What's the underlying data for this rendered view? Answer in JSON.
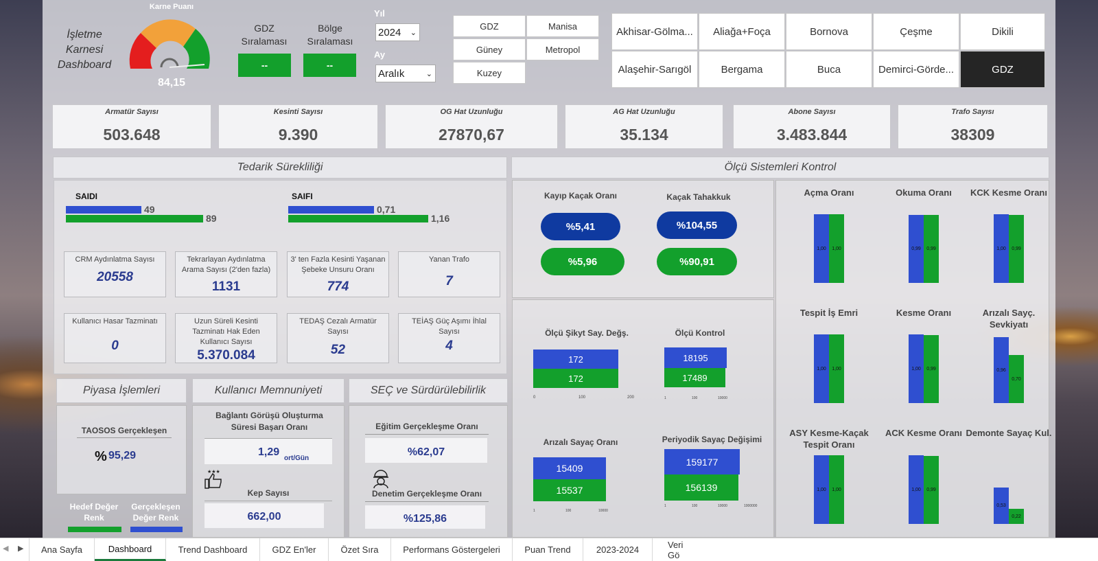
{
  "header": {
    "title_line1": "İşletme",
    "title_line2": "Karnesi",
    "title_line3": "Dashboard",
    "gauge_label": "Karne Puanı",
    "gauge_value": "84,15",
    "gdz_rank_label_1": "GDZ",
    "gdz_rank_label_2": "Sıralaması",
    "region_rank_label_1": "Bölge",
    "region_rank_label_2": "Sıralaması",
    "gdz_rank_value": "--",
    "region_rank_value": "--",
    "year_label": "Yıl",
    "year_value": "2024",
    "month_label": "Ay",
    "month_value": "Aralık"
  },
  "region_buttons": [
    "GDZ",
    "Manisa",
    "Güney",
    "Metropol",
    "Kuzey"
  ],
  "district_buttons": [
    "Akhisar-Gölma...",
    "Aliağa+Foça",
    "Bornova",
    "Çeşme",
    "Dikili",
    "Alaşehir-Sarıgöl",
    "Bergama",
    "Buca",
    "Demirci-Görde...",
    "GDZ"
  ],
  "kpis": [
    {
      "label": "Armatür  Sayısı",
      "value": "503.648"
    },
    {
      "label": "Kesinti Sayısı",
      "value": "9.390"
    },
    {
      "label": "OG Hat Uzunluğu",
      "value": "27870,67"
    },
    {
      "label": "AG Hat Uzunluğu",
      "value": "35.134"
    },
    {
      "label": "Abone Sayısı",
      "value": "3.483.844"
    },
    {
      "label": "Trafo Sayısı",
      "value": "38309"
    }
  ],
  "sections": {
    "supply": "Tedarik Sürekliliği",
    "measure": "Ölçü Sistemleri Kontrol",
    "market": "Piyasa İşlemleri",
    "satisfaction": "Kullanıcı Memnuniyeti",
    "sec": "SEÇ ve Sürdürülebilirlik"
  },
  "saidi": {
    "label": "SAIDI",
    "blue": "49",
    "green": "89",
    "blue_value": 49,
    "green_value": 89
  },
  "saifi": {
    "label": "SAIFI",
    "blue": "0,71",
    "green": "1,16",
    "blue_value": 0.71,
    "green_value": 1.16
  },
  "cards": [
    {
      "title": "CRM Aydınlatma Sayısı",
      "value": "20558"
    },
    {
      "title": "Tekrarlayan Aydınlatma Arama Sayısı (2'den fazla)",
      "value": "1131"
    },
    {
      "title": "3' ten Fazla Kesinti Yaşanan Şebeke Unsuru Oranı",
      "value": "774"
    },
    {
      "title": "Yanan Trafo",
      "value": "7"
    },
    {
      "title": "Kullanıcı Hasar Tazminatı",
      "value": "0"
    },
    {
      "title": "Uzun Süreli Kesinti Tazminatı Hak Eden Kullanıcı Sayısı",
      "value": "5.370.084"
    },
    {
      "title": "TEDAŞ Cezalı Armatür Sayısı",
      "value": "52"
    },
    {
      "title": "TEİAŞ Güç Aşımı İhlal Sayısı",
      "value": "4"
    }
  ],
  "market": {
    "title": "TAOSOS Gerçekleşen",
    "prefix": "%",
    "value": "95,29",
    "legend_target": "Hedef Değer Renk",
    "legend_actual": "Gerçekleşen Değer Renk"
  },
  "satisfaction": {
    "conn_title": "Bağlantı Görüşü Oluşturma Süresi Başarı Oranı",
    "conn_value": "1,29",
    "conn_unit": "ort/Gün",
    "kep_title": "Kep Sayısı",
    "kep_value": "662,00"
  },
  "sec": {
    "edu_title": "Eğitim Gerçekleşme Oranı",
    "edu_value": "%62,07",
    "audit_title": "Denetim Gerçekleşme Oranı",
    "audit_value": "%125,86"
  },
  "loss": {
    "title1": "Kayıp Kaçak Oranı",
    "title2": "Kaçak Tahakkuk",
    "blue1": "%5,41",
    "green1": "%5,96",
    "blue2": "%104,55",
    "green2": "%90,91"
  },
  "meter": {
    "complaint_title": "Ölçü Şikyt Say. Değş.",
    "complaint_blue": "172",
    "complaint_green": "172",
    "complaint_ticks": [
      "0",
      "100",
      "200"
    ],
    "control_title": "Ölçü Kontrol",
    "control_blue": "18195",
    "control_green": "17489",
    "control_ticks": [
      "1",
      "100",
      "10000"
    ],
    "faulty_title": "Arızalı Sayaç Oranı",
    "faulty_blue": "15409",
    "faulty_green": "15537",
    "faulty_ticks": [
      "1",
      "100",
      "10000"
    ],
    "periodic_title": "Periyodik Sayaç Değişimi",
    "periodic_blue": "159177",
    "periodic_green": "156139",
    "periodic_ticks": [
      "1",
      "100",
      "10000",
      "1000000"
    ]
  },
  "ratios": [
    {
      "title": "Açma Oranı",
      "blue": "1,00",
      "green": "1,00",
      "bv": 1.0,
      "gv": 1.0
    },
    {
      "title": "Okuma Oranı",
      "blue": "0,99",
      "green": "0,99",
      "bv": 0.99,
      "gv": 0.99
    },
    {
      "title": "KCK Kesme Oranı",
      "blue": "1,00",
      "green": "0,99",
      "bv": 1.0,
      "gv": 0.99
    },
    {
      "title": "Tespit İş Emri",
      "blue": "1,00",
      "green": "1,00",
      "bv": 1.0,
      "gv": 1.0
    },
    {
      "title": "Kesme Oranı",
      "blue": "1,00",
      "green": "0,99",
      "bv": 1.0,
      "gv": 0.99
    },
    {
      "title": "Arızalı Sayç. Sevkiyatı",
      "blue": "0,96",
      "green": "0,70",
      "bv": 0.96,
      "gv": 0.7
    },
    {
      "title": "ASY Kesme-Kaçak Tespit Oranı",
      "blue": "1,00",
      "green": "1,00",
      "bv": 1.0,
      "gv": 1.0
    },
    {
      "title": "ACK Kesme Oranı",
      "blue": "1,00",
      "green": "0,99",
      "bv": 1.0,
      "gv": 0.99
    },
    {
      "title": "Demonte Sayaç Kul.",
      "blue": "0,53",
      "green": "0,22",
      "bv": 0.53,
      "gv": 0.22
    }
  ],
  "tabs": [
    "Ana Sayfa",
    "Dashboard",
    "Trend Dashboard",
    "GDZ En'ler",
    "Özet Sıra",
    "Performans Göstergeleri",
    "Puan Trend",
    "2023-2024",
    "Veri Gö"
  ],
  "colors": {
    "blue": "#2f4fd0",
    "green": "#13a02c",
    "darkpill": "#0f3aa0",
    "red": "#e41e1e",
    "orange": "#f2a13a"
  }
}
